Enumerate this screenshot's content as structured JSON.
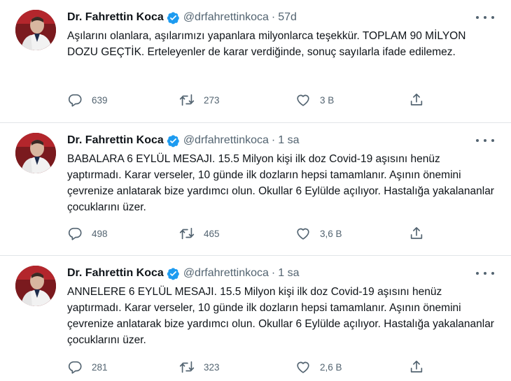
{
  "tweets": [
    {
      "author": "Dr. Fahrettin Koca",
      "handle": "@drfahrettinkoca",
      "separator": "·",
      "time": "57d",
      "text": "Aşılarını olanlara, aşılarımızı yapanlara milyonlarca teşekkür. TOPLAM 90 MİLYON DOZU GEÇTİK. Erteleyenler de karar verdiğinde, sonuç sayılarla ifade edilemez.",
      "replies": "639",
      "retweets": "273",
      "likes": "3 B",
      "share": ""
    },
    {
      "author": "Dr. Fahrettin Koca",
      "handle": "@drfahrettinkoca",
      "separator": "·",
      "time": "1 sa",
      "text": "BABALARA 6 EYLÜL MESAJI. 15.5 Milyon kişi ilk doz Covid-19 aşısını henüz yaptırmadı. Karar verseler, 10 günde ilk dozların hepsi tamamlanır. Aşının önemini çevrenize anlatarak bize yardımcı olun. Okullar 6 Eylülde açılıyor. Hastalığa yakalananlar çocuklarını üzer.",
      "replies": "498",
      "retweets": "465",
      "likes": "3,6 B",
      "share": ""
    },
    {
      "author": "Dr. Fahrettin Koca",
      "handle": "@drfahrettinkoca",
      "separator": "·",
      "time": "1 sa",
      "text": "ANNELERE 6 EYLÜL MESAJI. 15.5 Milyon kişi ilk doz Covid-19 aşısını henüz yaptırmadı. Karar verseler, 10 günde ilk dozların hepsi tamamlanır. Aşının önemini çevrenize anlatarak bize yardımcı olun. Okullar 6 Eylülde açılıyor. Hastalığa yakalananlar çocuklarını üzer.",
      "replies": "281",
      "retweets": "323",
      "likes": "2,6 B",
      "share": ""
    }
  ],
  "icons": {
    "verified": "verified-badge-icon",
    "more": "more-options-icon",
    "reply": "reply-icon",
    "retweet": "retweet-icon",
    "like": "heart-icon",
    "share": "share-icon"
  },
  "colors": {
    "verified": "#1d9bf0",
    "text": "#0f1419",
    "muted": "#536471",
    "divider": "#e1e5e8",
    "avatar_bg": "#7a1a1e"
  }
}
